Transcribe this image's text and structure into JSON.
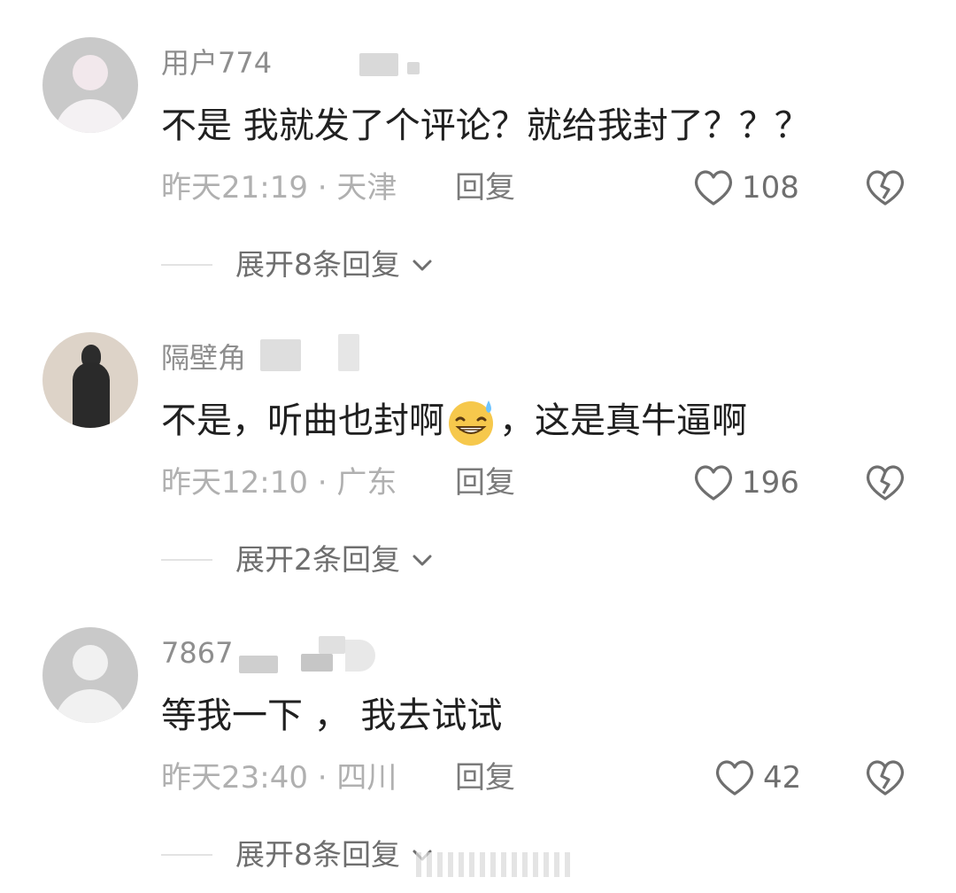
{
  "comments": [
    {
      "username": "用户774",
      "text": "不是 我就发了个评论？就给我封了？？？",
      "time": "昨天21:19",
      "location": "天津",
      "separator": "·",
      "reply_label": "回复",
      "likes": "108",
      "expand_label": "展开8条回复"
    },
    {
      "username": "隔壁角",
      "text_before": "不是，听曲也封啊",
      "text_after": "，这是真牛逼啊",
      "emoji": "grinning-sweat-emoji",
      "time": "昨天12:10",
      "location": "广东",
      "separator": "·",
      "reply_label": "回复",
      "likes": "196",
      "expand_label": "展开2条回复"
    },
    {
      "username": "7867",
      "text": "等我一下 ， 我去试试",
      "time": "昨天23:40",
      "location": "四川",
      "separator": "·",
      "reply_label": "回复",
      "likes": "42",
      "expand_label": "展开8条回复"
    }
  ],
  "icons": {
    "like": "heart-outline-icon",
    "dislike": "broken-heart-icon",
    "expand": "chevron-down-icon"
  },
  "colors": {
    "text": "#202020",
    "meta": "#b0b0b0",
    "username": "#8e8e8e",
    "icon": "#6f6f6f"
  }
}
